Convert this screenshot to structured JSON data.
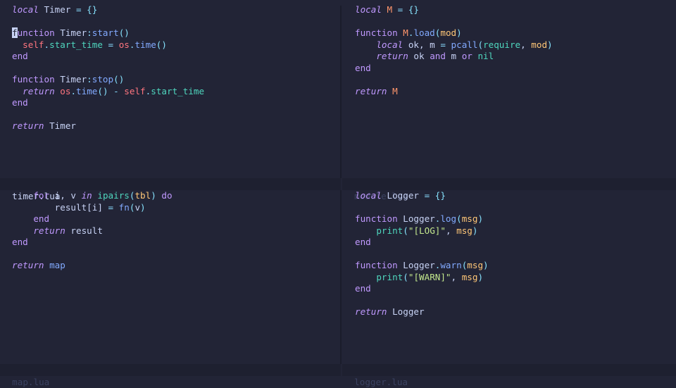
{
  "panes": {
    "timer": {
      "filename": "timer.lua",
      "lines": [
        [
          [
            "kwi",
            "local"
          ],
          [
            "id",
            " Timer "
          ],
          [
            "op",
            "="
          ],
          [
            "pr",
            " {}"
          ]
        ],
        [],
        [
          [
            "cursor",
            "f"
          ],
          [
            "kw",
            "unction"
          ],
          [
            "id",
            " Timer"
          ],
          [
            "op",
            ":"
          ],
          [
            "fn",
            "start"
          ],
          [
            "pr",
            "()"
          ]
        ],
        [
          [
            "id",
            "  "
          ],
          [
            "slf",
            "self"
          ],
          [
            "op",
            "."
          ],
          [
            "fld",
            "start_time"
          ],
          [
            "op",
            " = "
          ],
          [
            "lib",
            "os"
          ],
          [
            "op",
            "."
          ],
          [
            "fn",
            "time"
          ],
          [
            "pr",
            "()"
          ]
        ],
        [
          [
            "kw",
            "end"
          ]
        ],
        [],
        [
          [
            "kw",
            "function"
          ],
          [
            "id",
            " Timer"
          ],
          [
            "op",
            ":"
          ],
          [
            "fn",
            "stop"
          ],
          [
            "pr",
            "()"
          ]
        ],
        [
          [
            "id",
            "  "
          ],
          [
            "ret",
            "return"
          ],
          [
            "id",
            " "
          ],
          [
            "lib",
            "os"
          ],
          [
            "op",
            "."
          ],
          [
            "fn",
            "time"
          ],
          [
            "pr",
            "()"
          ],
          [
            "op",
            " - "
          ],
          [
            "slf",
            "self"
          ],
          [
            "op",
            "."
          ],
          [
            "fld",
            "start_time"
          ]
        ],
        [
          [
            "kw",
            "end"
          ]
        ],
        [],
        [
          [
            "ret",
            "return"
          ],
          [
            "id",
            " Timer"
          ]
        ]
      ]
    },
    "module": {
      "filename": "module.lua",
      "lines": [
        [
          [
            "kwi",
            "local"
          ],
          [
            "mod",
            " M"
          ],
          [
            "op",
            " ="
          ],
          [
            "pr",
            " {}"
          ]
        ],
        [],
        [
          [
            "kw",
            "function"
          ],
          [
            "mod",
            " M"
          ],
          [
            "op",
            "."
          ],
          [
            "fn",
            "load"
          ],
          [
            "pr",
            "("
          ],
          [
            "par",
            "mod"
          ],
          [
            "pr",
            ")"
          ]
        ],
        [
          [
            "id",
            "    "
          ],
          [
            "kwi",
            "local"
          ],
          [
            "id",
            " ok, m "
          ],
          [
            "op",
            "="
          ],
          [
            "id",
            " "
          ],
          [
            "fn",
            "pcall"
          ],
          [
            "pr",
            "("
          ],
          [
            "bi",
            "require"
          ],
          [
            "id",
            ", "
          ],
          [
            "par",
            "mod"
          ],
          [
            "pr",
            ")"
          ]
        ],
        [
          [
            "id",
            "    "
          ],
          [
            "ret",
            "return"
          ],
          [
            "id",
            " ok "
          ],
          [
            "kw",
            "and"
          ],
          [
            "id",
            " m "
          ],
          [
            "kw",
            "or"
          ],
          [
            "id",
            " "
          ],
          [
            "bi",
            "nil"
          ]
        ],
        [
          [
            "kw",
            "end"
          ]
        ],
        [],
        [
          [
            "ret",
            "return"
          ],
          [
            "mod",
            " M"
          ]
        ]
      ]
    },
    "map": {
      "filename": "map.lua",
      "lines": [
        [
          [
            "id",
            "    "
          ],
          [
            "kw",
            "for"
          ],
          [
            "id",
            " i, v "
          ],
          [
            "kwi",
            "in"
          ],
          [
            "id",
            " "
          ],
          [
            "bi",
            "ipairs"
          ],
          [
            "pr",
            "("
          ],
          [
            "par",
            "tbl"
          ],
          [
            "pr",
            ")"
          ],
          [
            "kw",
            " do"
          ]
        ],
        [
          [
            "id",
            "        result[i] "
          ],
          [
            "op",
            "="
          ],
          [
            "id",
            " "
          ],
          [
            "fn",
            "fn"
          ],
          [
            "pr",
            "("
          ],
          [
            "id",
            "v"
          ],
          [
            "pr",
            ")"
          ]
        ],
        [
          [
            "id",
            "    "
          ],
          [
            "kw",
            "end"
          ]
        ],
        [
          [
            "id",
            "    "
          ],
          [
            "ret",
            "return"
          ],
          [
            "id",
            " result"
          ]
        ],
        [
          [
            "kw",
            "end"
          ]
        ],
        [],
        [
          [
            "ret",
            "return"
          ],
          [
            "fn",
            " map"
          ]
        ]
      ]
    },
    "logger": {
      "filename": "logger.lua",
      "lines": [
        [
          [
            "kwi",
            "local"
          ],
          [
            "id",
            " Logger "
          ],
          [
            "op",
            "="
          ],
          [
            "pr",
            " {}"
          ]
        ],
        [],
        [
          [
            "kw",
            "function"
          ],
          [
            "id",
            " Logger"
          ],
          [
            "op",
            "."
          ],
          [
            "fn",
            "log"
          ],
          [
            "pr",
            "("
          ],
          [
            "par",
            "msg"
          ],
          [
            "pr",
            ")"
          ]
        ],
        [
          [
            "id",
            "    "
          ],
          [
            "bi",
            "print"
          ],
          [
            "pr",
            "("
          ],
          [
            "str",
            "\"[LOG]\""
          ],
          [
            "id",
            ", "
          ],
          [
            "par",
            "msg"
          ],
          [
            "pr",
            ")"
          ]
        ],
        [
          [
            "kw",
            "end"
          ]
        ],
        [],
        [
          [
            "kw",
            "function"
          ],
          [
            "id",
            " Logger"
          ],
          [
            "op",
            "."
          ],
          [
            "fn",
            "warn"
          ],
          [
            "pr",
            "("
          ],
          [
            "par",
            "msg"
          ],
          [
            "pr",
            ")"
          ]
        ],
        [
          [
            "id",
            "    "
          ],
          [
            "bi",
            "print"
          ],
          [
            "pr",
            "("
          ],
          [
            "str",
            "\"[WARN]\""
          ],
          [
            "id",
            ", "
          ],
          [
            "par",
            "msg"
          ],
          [
            "pr",
            ")"
          ]
        ],
        [
          [
            "kw",
            "end"
          ]
        ],
        [],
        [
          [
            "ret",
            "return"
          ],
          [
            "id",
            " Logger"
          ]
        ]
      ]
    }
  }
}
